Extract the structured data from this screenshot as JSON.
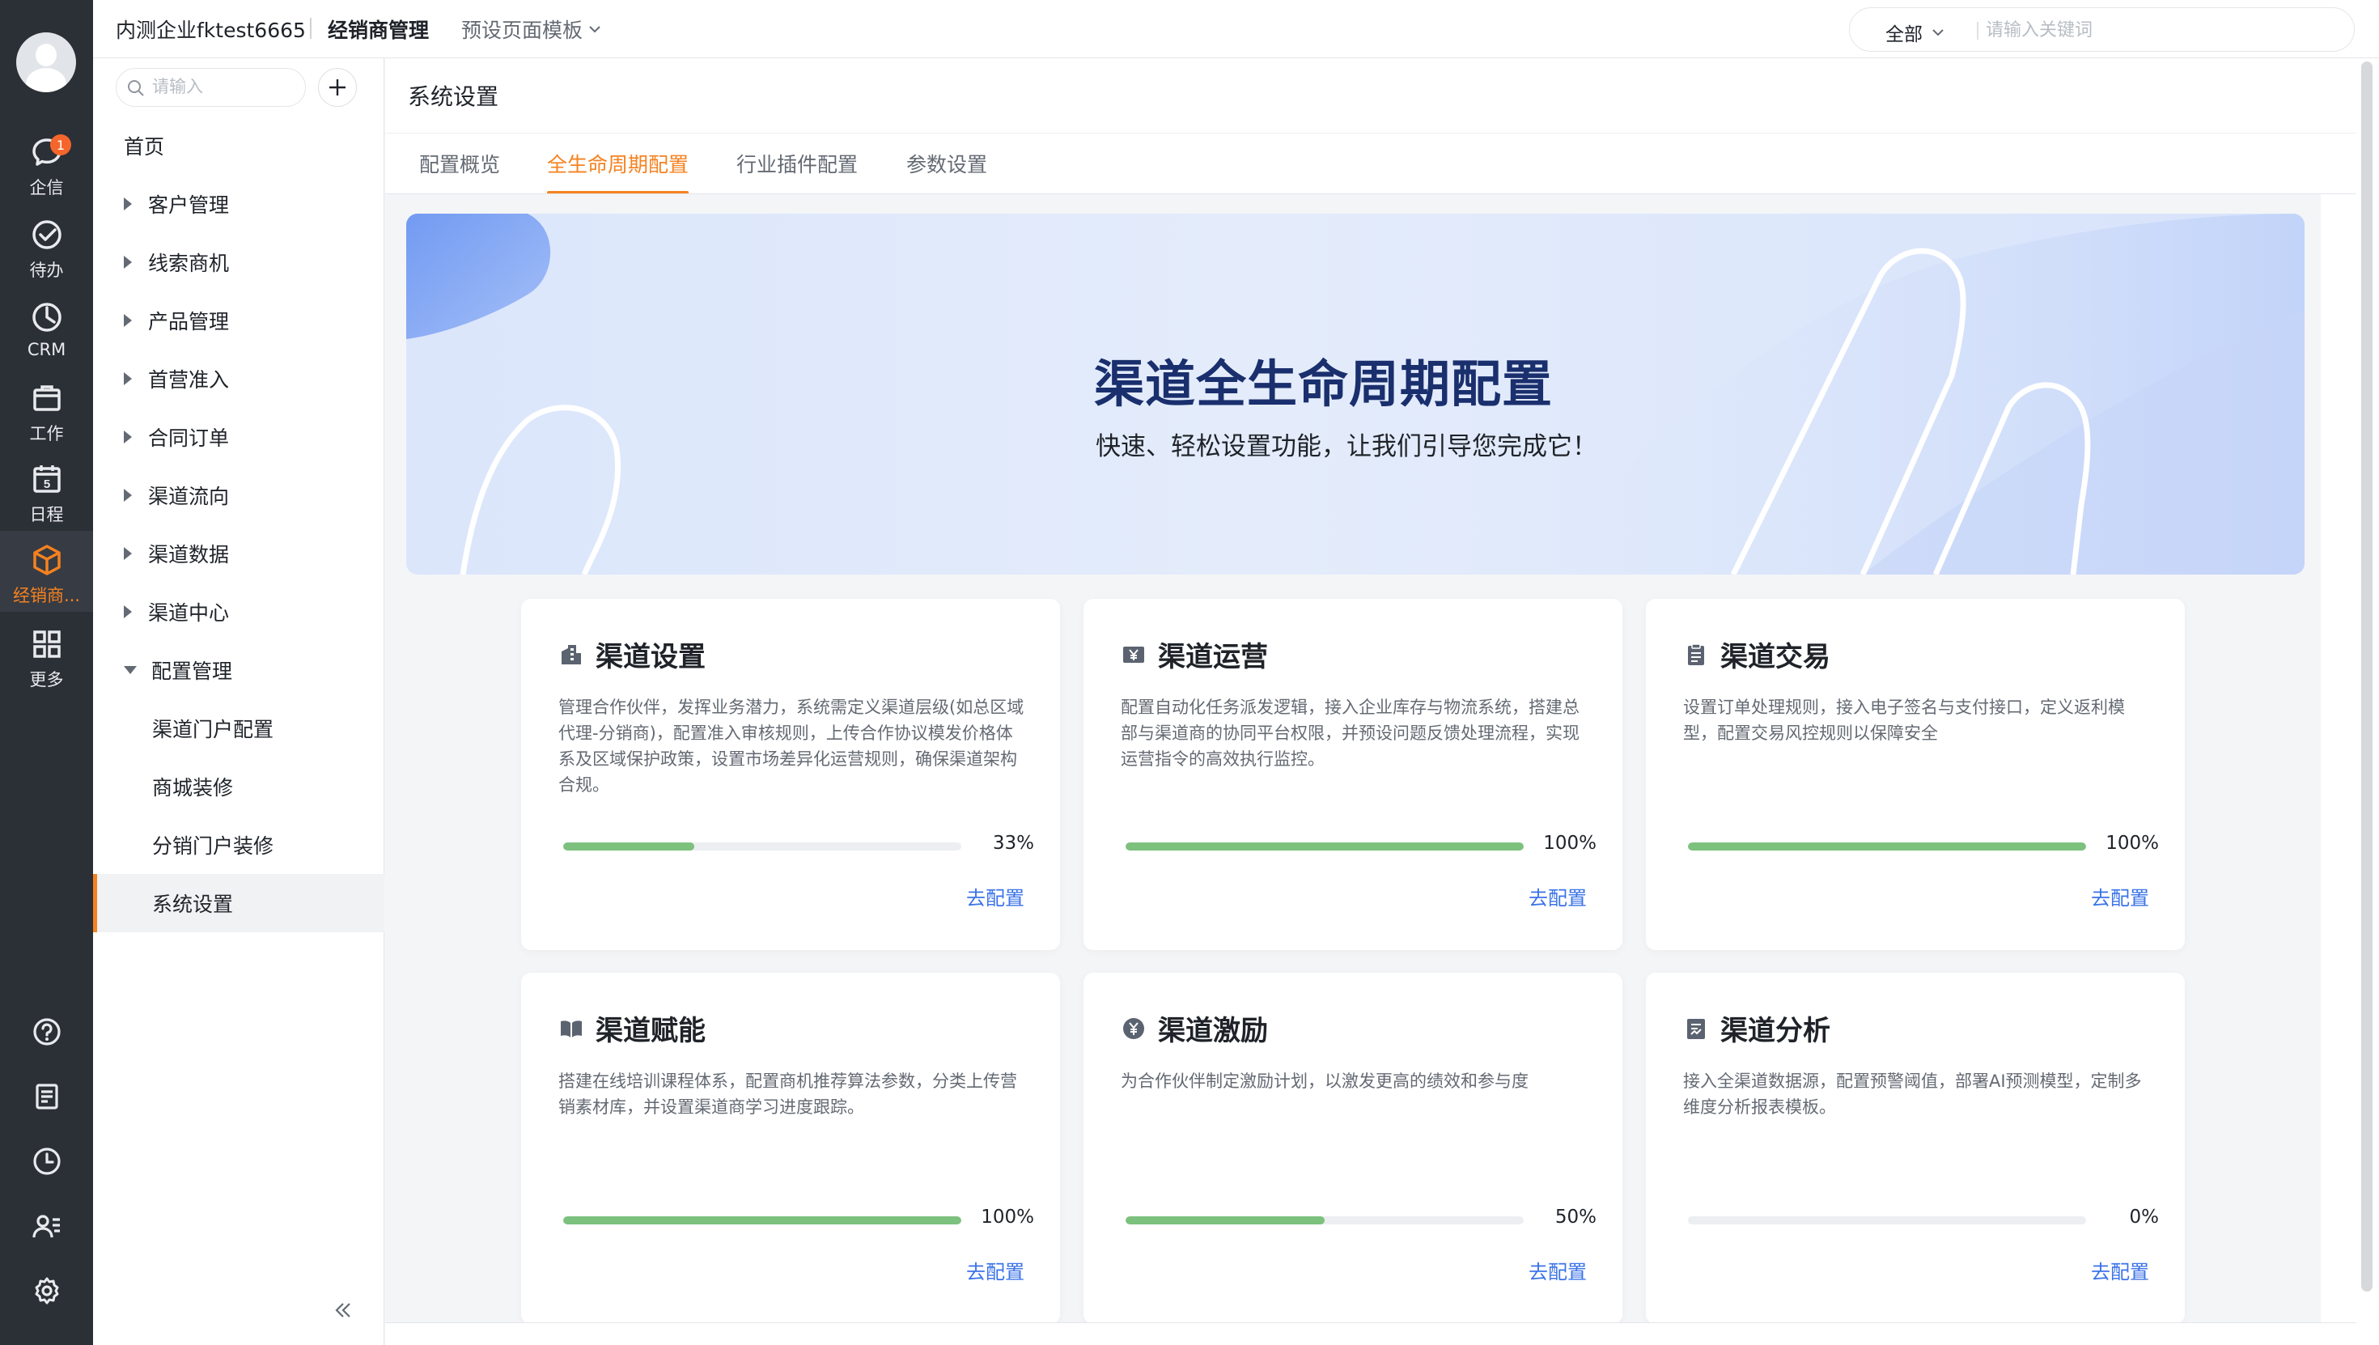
{
  "rail": {
    "items": [
      {
        "label": "企信",
        "icon": "chat-icon",
        "badge": "1"
      },
      {
        "label": "待办",
        "icon": "check-circle-icon"
      },
      {
        "label": "CRM",
        "icon": "clock-pie-icon"
      },
      {
        "label": "工作",
        "icon": "briefcase-icon"
      },
      {
        "label": "日程",
        "icon": "calendar-icon",
        "calendar_day": "5"
      },
      {
        "label": "经销商...",
        "icon": "cube-icon",
        "active": true
      },
      {
        "label": "更多",
        "icon": "grid-icon"
      }
    ],
    "bottom_icons": [
      "help-icon",
      "notebook-icon",
      "history-icon",
      "contacts-icon",
      "settings-icon"
    ],
    "accent_color": "#f58220"
  },
  "topbar": {
    "company": "内测企业fktest6665",
    "module": "经销商管理",
    "template": "预设页面模板",
    "search_scope": "全部",
    "search_placeholder": "请输入关键词"
  },
  "sidenav": {
    "search_placeholder": "请输入",
    "add_icon": "plus-icon",
    "items": [
      {
        "label": "首页"
      },
      {
        "label": "客户管理",
        "expandable": true
      },
      {
        "label": "线索商机",
        "expandable": true
      },
      {
        "label": "产品管理",
        "expandable": true
      },
      {
        "label": "首营准入",
        "expandable": true
      },
      {
        "label": "合同订单",
        "expandable": true
      },
      {
        "label": "渠道流向",
        "expandable": true
      },
      {
        "label": "渠道数据",
        "expandable": true
      },
      {
        "label": "渠道中心",
        "expandable": true
      },
      {
        "label": "配置管理",
        "expandable": true,
        "expanded": true
      },
      {
        "label": "渠道门户配置",
        "sub": true
      },
      {
        "label": "商城装修",
        "sub": true
      },
      {
        "label": "分销门户装修",
        "sub": true
      },
      {
        "label": "系统设置",
        "sub": true,
        "selected": true
      }
    ],
    "collapse_icon": "double-chevron-left-icon"
  },
  "main": {
    "title": "系统设置",
    "tabs": [
      {
        "label": "配置概览"
      },
      {
        "label": "全生命周期配置",
        "active": true
      },
      {
        "label": "行业插件配置"
      },
      {
        "label": "参数设置"
      }
    ],
    "banner": {
      "title": "渠道全生命周期配置",
      "subtitle": "快速、轻松设置功能，让我们引导您完成它！"
    },
    "cards": [
      {
        "title": "渠道设置",
        "icon": "building-icon",
        "desc": "管理合作伙伴，发挥业务潜力，系统需定义渠道层级(如总区域代理-分销商)，配置准入审核规则，上传合作协议模发价格体系及区域保护政策，设置市场差异化运营规则，确保渠道架构合规。",
        "progress": 33,
        "progress_label": "33%",
        "link": "去配置"
      },
      {
        "title": "渠道运营",
        "icon": "yen-box-icon",
        "desc": "配置自动化任务派发逻辑，接入企业库存与物流系统，搭建总部与渠道商的协同平台权限，并预设问题反馈处理流程，实现运营指令的高效执行监控。",
        "progress": 100,
        "progress_label": "100%",
        "link": "去配置"
      },
      {
        "title": "渠道交易",
        "icon": "clipboard-icon",
        "desc": "设置订单处理规则，接入电子签名与支付接口，定义返利模型，配置交易风控规则以保障安全",
        "progress": 100,
        "progress_label": "100%",
        "link": "去配置"
      },
      {
        "title": "渠道赋能",
        "icon": "book-icon",
        "desc": "搭建在线培训课程体系，配置商机推荐算法参数，分类上传营销素材库，并设置渠道商学习进度跟踪。",
        "progress": 100,
        "progress_label": "100%",
        "link": "去配置"
      },
      {
        "title": "渠道激励",
        "icon": "yen-coin-icon",
        "desc": "为合作伙伴制定激励计划，以激发更高的绩效和参与度",
        "progress": 50,
        "progress_label": "50%",
        "link": "去配置"
      },
      {
        "title": "渠道分析",
        "icon": "report-icon",
        "desc": "接入全渠道数据源，配置预警阈值，部署AI预测模型，定制多维度分析报表模板。",
        "progress": 0,
        "progress_label": "0%",
        "link": "去配置"
      }
    ],
    "progress_color": "#7cc17d",
    "link_color": "#3b73e8"
  }
}
